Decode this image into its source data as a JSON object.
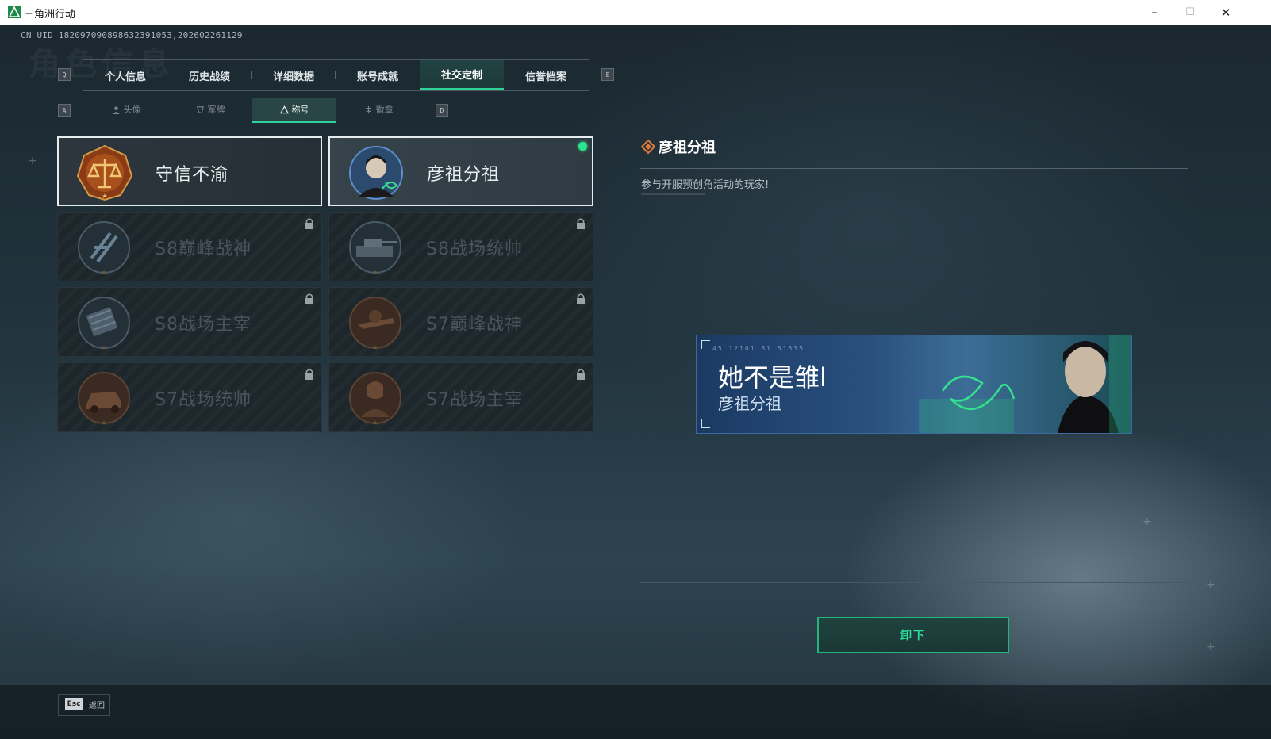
{
  "window": {
    "title": "三角洲行动",
    "minimize_glyph": "–",
    "maximize_glyph": "☐",
    "close_glyph": "✕"
  },
  "uid_text": "CN UID 182097090898632391053,202602261129",
  "watermark_text": "角色信息",
  "keys": {
    "prev_tab": "Q",
    "next_tab": "E",
    "prev_subtab": "A",
    "next_subtab": "D"
  },
  "tabs": [
    {
      "label": "个人信息",
      "active": false
    },
    {
      "label": "历史战绩",
      "active": false
    },
    {
      "label": "详细数据",
      "active": false
    },
    {
      "label": "账号成就",
      "active": false
    },
    {
      "label": "社交定制",
      "active": true
    },
    {
      "label": "信誉档案",
      "active": false
    }
  ],
  "subtabs": [
    {
      "label": "头像",
      "icon": "person-icon",
      "active": false
    },
    {
      "label": "军牌",
      "icon": "dogtag-icon",
      "active": false
    },
    {
      "label": "称号",
      "icon": "title-triangle-icon",
      "active": true
    },
    {
      "label": "徽章",
      "icon": "emblem-icon",
      "active": false
    }
  ],
  "titles": [
    {
      "label": "守信不渝",
      "state": "unlocked",
      "badge": "scales-badge-icon"
    },
    {
      "label": "彦祖分祖",
      "state": "selected",
      "badge": "portrait-badge-icon",
      "equipped": true
    },
    {
      "label": "S8巅峰战神",
      "state": "locked",
      "badge": "slash-badge-icon"
    },
    {
      "label": "S8战场统帅",
      "state": "locked",
      "badge": "tank-badge-icon"
    },
    {
      "label": "S8战场主宰",
      "state": "locked",
      "badge": "missile-badge-icon"
    },
    {
      "label": "S7巅峰战神",
      "state": "locked",
      "badge": "gun-badge-icon"
    },
    {
      "label": "S7战场统帅",
      "state": "locked",
      "badge": "vehicle-badge-icon"
    },
    {
      "label": "S7战场主宰",
      "state": "locked",
      "badge": "soldier-badge-icon"
    }
  ],
  "detail": {
    "title": "彦祖分祖",
    "description": "参与开服预创角活动的玩家!",
    "banner_name": "她不是雏l",
    "banner_title": "彦祖分祖",
    "banner_code": "45 12101  81 51635",
    "action_label": "卸下"
  },
  "footer": {
    "esc_key": "Esc",
    "back_label": "返回"
  },
  "colors": {
    "accent": "#2fd39a",
    "equipped": "#2ee58f",
    "diamond": "#e07a3a"
  }
}
